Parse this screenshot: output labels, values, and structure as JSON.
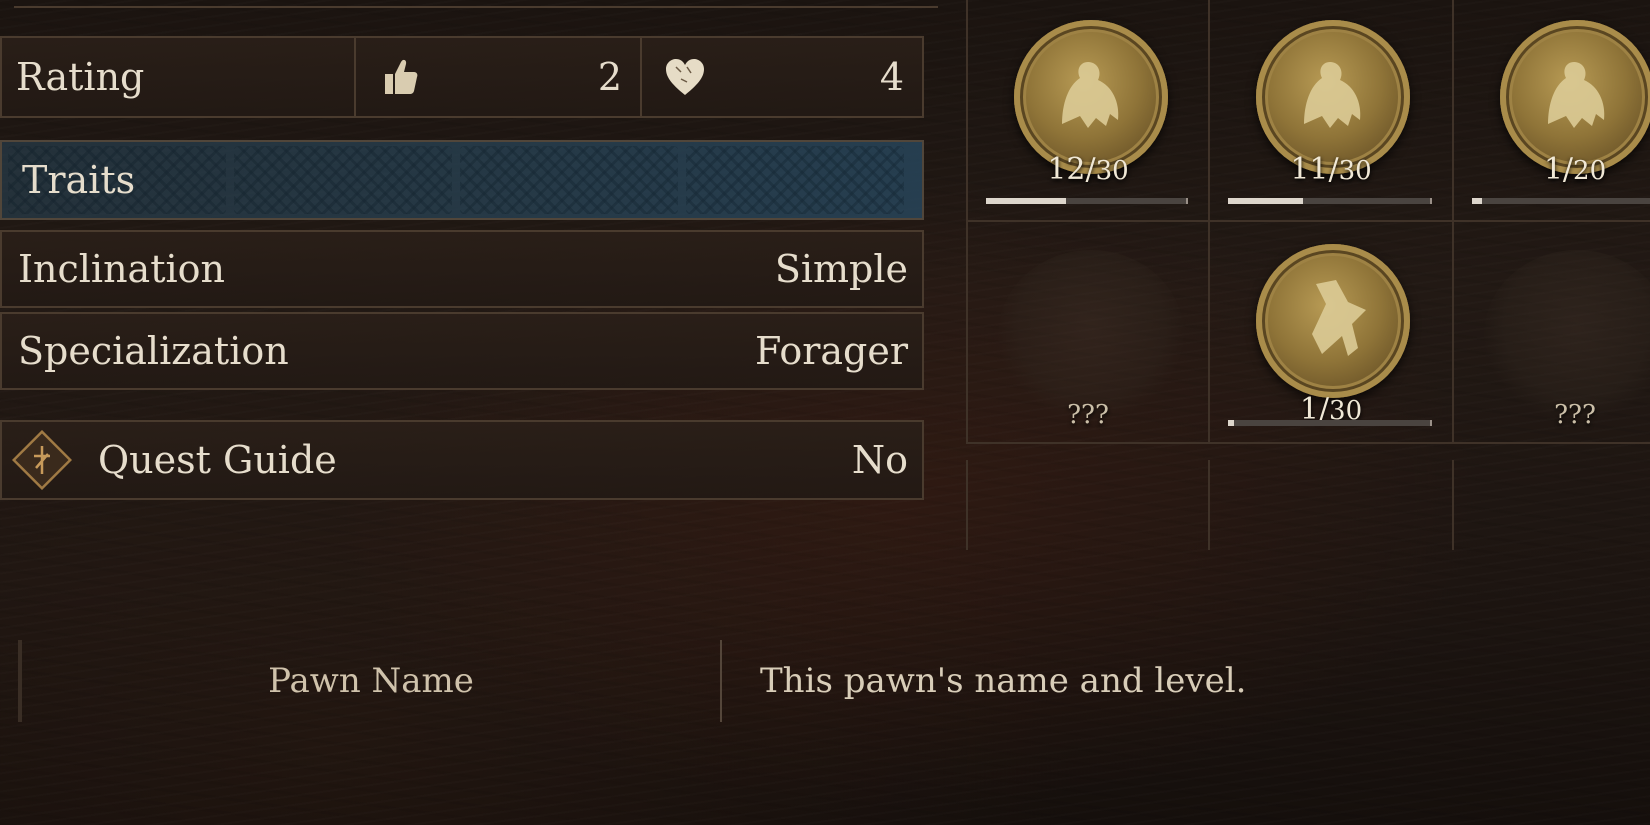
{
  "info": {
    "rating": {
      "label": "Rating",
      "thumbs_value": "2",
      "heart_value": "4"
    },
    "traits": {
      "label": "Traits"
    },
    "inclination": {
      "label": "Inclination",
      "value": "Simple"
    },
    "specialization": {
      "label": "Specialization",
      "value": "Forager"
    },
    "quest_guide": {
      "label": "Quest Guide",
      "value": "No"
    }
  },
  "medals": [
    {
      "num": "12/",
      "den": "30",
      "progress": 0.4,
      "icon": "ogre-medal-icon"
    },
    {
      "num": "11/",
      "den": "30",
      "progress": 0.37,
      "icon": "ogre-medal-icon"
    },
    {
      "num": "1/",
      "den": "20",
      "progress": 0.05,
      "icon": "ogre-medal-icon"
    },
    {
      "unknown": "???",
      "icon": "unknown-medal-icon"
    },
    {
      "num": "1/",
      "den": "30",
      "progress": 0.03,
      "icon": "beast-medal-icon"
    },
    {
      "unknown": "???",
      "icon": "unknown-medal-icon"
    }
  ],
  "description": {
    "title": "Pawn Name",
    "text": "This pawn's name and level."
  },
  "colors": {
    "text": "#e6ddcc",
    "border": "#4a3b2e",
    "traits_highlight": "#2f5468",
    "medal_gold": "#a98c4a"
  }
}
